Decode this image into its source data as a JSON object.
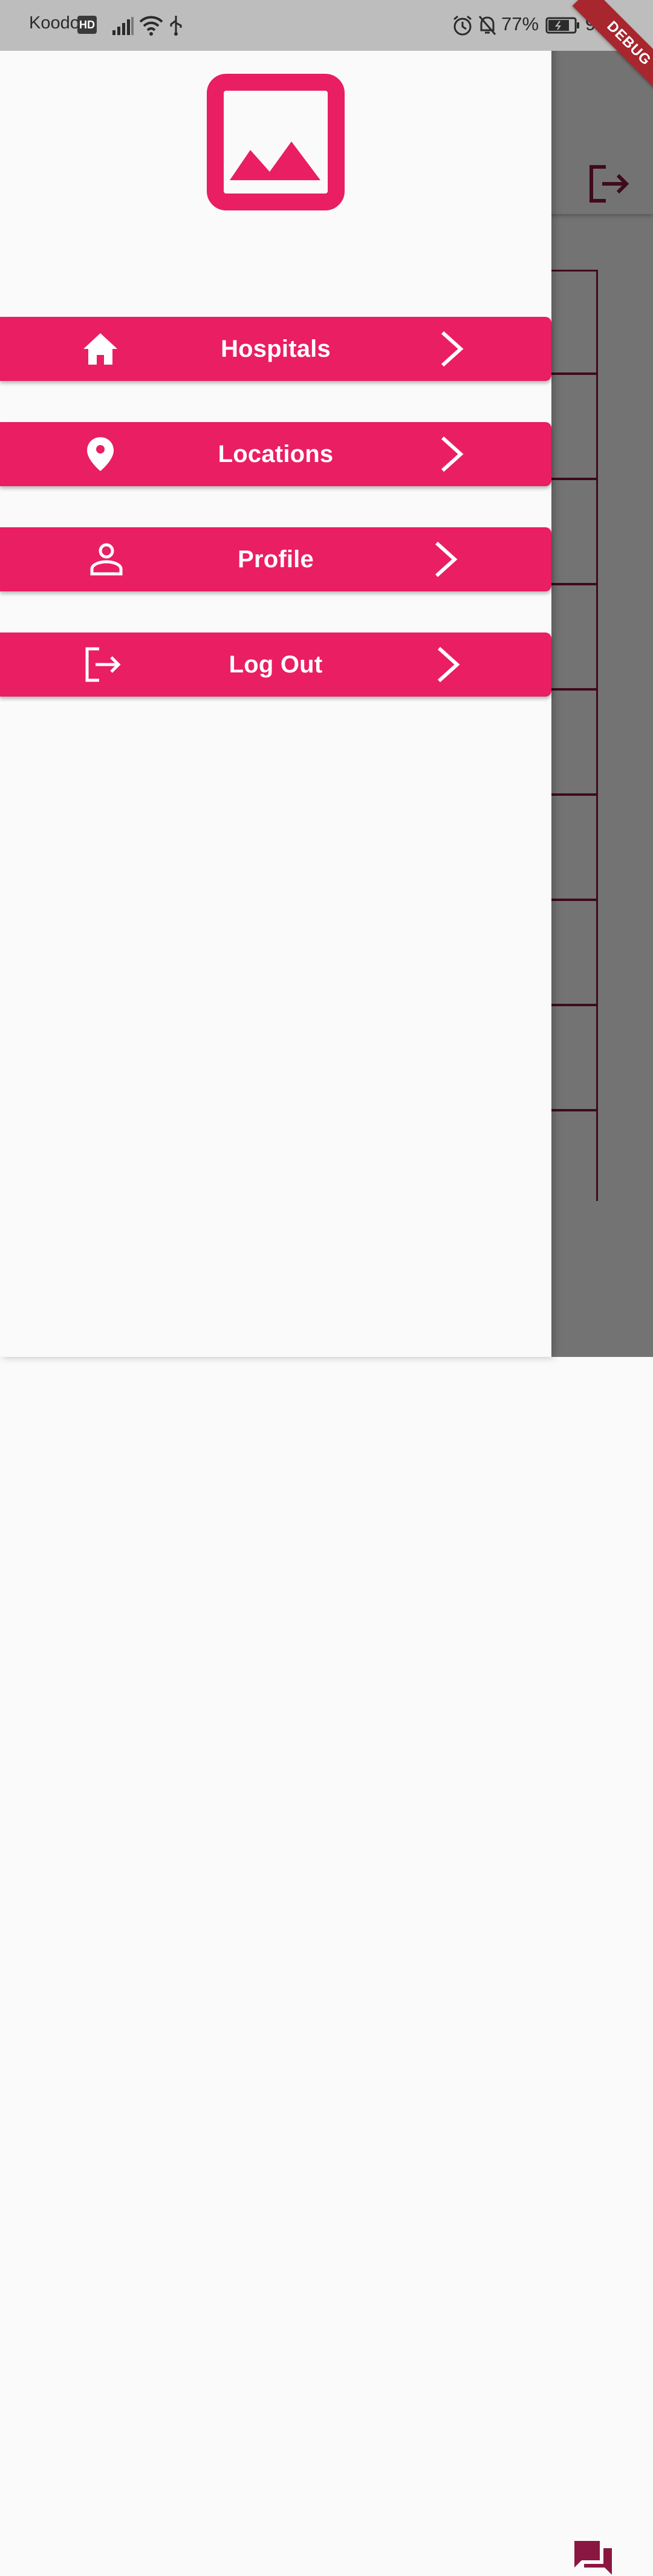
{
  "status_bar": {
    "carrier": "Koodo",
    "hd_badge": "HD",
    "battery_percent": "77%",
    "time": "9:19",
    "icons": [
      "signal-icon",
      "wifi-icon",
      "usb-icon",
      "alarm-icon",
      "notifications-off-icon",
      "battery-charging-icon"
    ]
  },
  "debug_banner": "DEBUG",
  "drawer": {
    "logo_icon": "image-icon",
    "menu": [
      {
        "label": "Hospitals",
        "icon": "home-icon"
      },
      {
        "label": "Locations",
        "icon": "location-pin-icon"
      },
      {
        "label": "Profile",
        "icon": "person-icon"
      },
      {
        "label": "Log Out",
        "icon": "logout-icon"
      }
    ]
  },
  "background_app": {
    "appbar_action_icon": "logout-icon",
    "bottom_action_icon": "chat-icon"
  },
  "colors": {
    "accent": "#e91e63",
    "accent_dark": "#8a1741",
    "drawer_background": "#fafafa",
    "status_bar": "#bdbdbd",
    "debug_ribbon": "#a8262d"
  }
}
